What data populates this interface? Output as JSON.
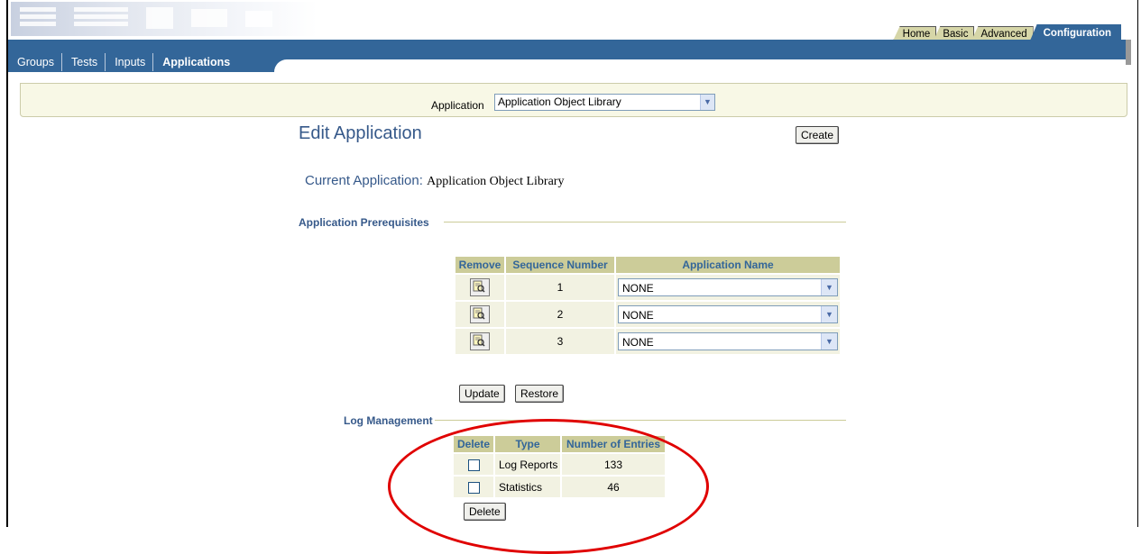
{
  "top_tabs": [
    "Home",
    "Basic",
    "Advanced",
    "Configuration"
  ],
  "sub_tabs": [
    "Groups",
    "Tests",
    "Inputs",
    "Applications"
  ],
  "filter": {
    "label": "Application",
    "value": "Application Object Library"
  },
  "page": {
    "title": "Edit Application",
    "create_label": "Create",
    "current_label": "Current Application:",
    "current_value": "Application Object Library"
  },
  "prereq": {
    "section": "Application Prerequisites",
    "headers": [
      "Remove",
      "Sequence Number",
      "Application Name"
    ],
    "rows": [
      {
        "seq": "1",
        "app": "NONE"
      },
      {
        "seq": "2",
        "app": "NONE"
      },
      {
        "seq": "3",
        "app": "NONE"
      }
    ],
    "update_label": "Update",
    "restore_label": "Restore"
  },
  "log": {
    "section": "Log Management",
    "headers": [
      "Delete",
      "Type",
      "Number of Entries"
    ],
    "rows": [
      {
        "type": "Log Reports",
        "count": "133"
      },
      {
        "type": "Statistics",
        "count": "46"
      }
    ],
    "delete_label": "Delete"
  },
  "colors": {
    "accent": "#336699",
    "tab_inactive": "#d6d6a8",
    "header_bg": "#cccc99",
    "annotation": "#e00000"
  },
  "icons": {
    "remove": "remove-icon",
    "dropdown": "chevron-down-icon",
    "logo": "logo"
  }
}
